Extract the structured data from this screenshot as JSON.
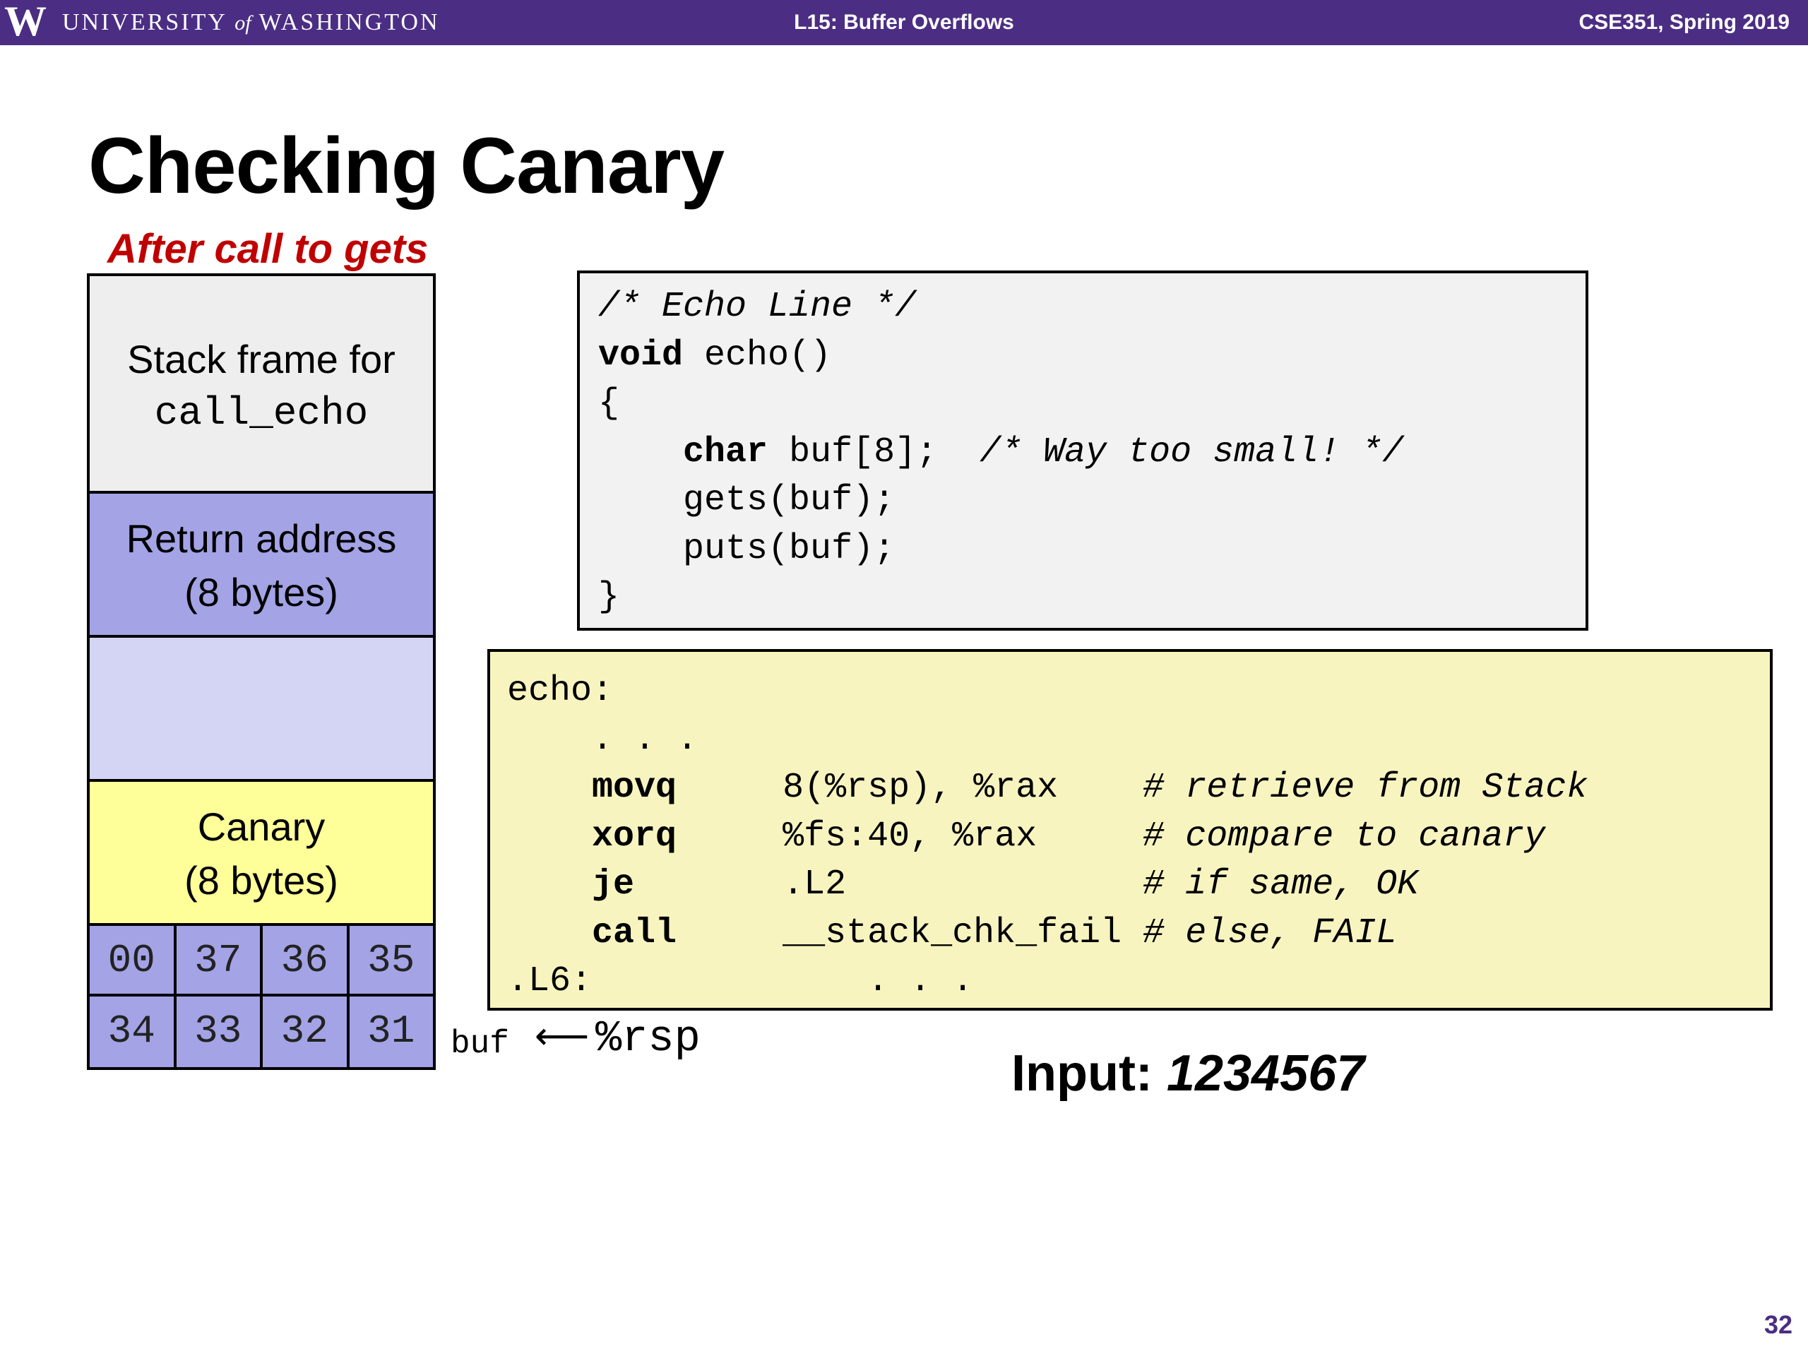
{
  "header": {
    "logo_letter": "W",
    "university_pre": "UNIVERSITY ",
    "university_of": "of",
    "university_post": " WASHINGTON",
    "lecture": "L15: Buffer Overflows",
    "course": "CSE351, Spring 2019"
  },
  "slide": {
    "title": "Checking Canary",
    "subtitle": "After call to gets",
    "page_number": "32"
  },
  "stack": {
    "frame_label": "Stack frame for",
    "frame_function": "call_echo",
    "return_label": "Return address",
    "return_size": "(8 bytes)",
    "canary_label": "Canary",
    "canary_size": "(8 bytes)",
    "bytes_row1": [
      "00",
      "37",
      "36",
      "35"
    ],
    "bytes_row2": [
      "34",
      "33",
      "32",
      "31"
    ],
    "buf_label": "buf",
    "arrow": "⟵",
    "rsp_label": "%rsp"
  },
  "c_code": {
    "comment": "/* Echo Line */",
    "void_kw": "void",
    "sig": " echo()",
    "open": "{",
    "char_kw": "char",
    "decl": " buf[8];  ",
    "decl_comment": "/* Way too small! */",
    "line_gets": "gets(buf);",
    "line_puts": "puts(buf);",
    "close": "}"
  },
  "asm": {
    "label_echo": "echo:",
    "dots1": ". . .",
    "rows": [
      {
        "op": "movq",
        "args": "8(%rsp), %rax    ",
        "comment": "# retrieve from Stack"
      },
      {
        "op": "xorq",
        "args": "%fs:40, %rax     ",
        "comment": "# compare to canary"
      },
      {
        "op": "je",
        "args": ".L2              ",
        "comment": "# if same, OK"
      },
      {
        "op": "call",
        "args": "__stack_chk_fail ",
        "comment": "# else, FAIL"
      }
    ],
    "label_l6": ".L6:",
    "dots2": ". . ."
  },
  "input": {
    "label": "Input: ",
    "value": "1234567"
  }
}
